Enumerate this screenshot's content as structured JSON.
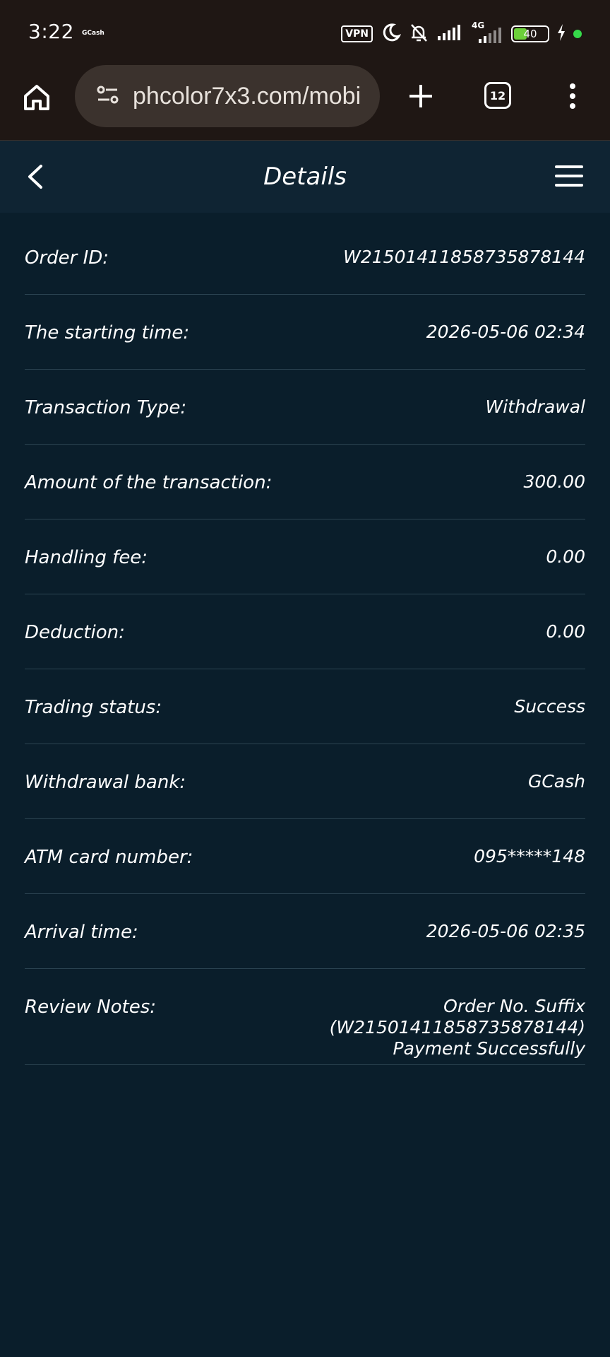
{
  "status_bar": {
    "time": "3:22",
    "notification": "GCash",
    "vpn": "VPN",
    "network": "4G",
    "battery": "40"
  },
  "browser": {
    "url": "phcolor7x3.com/mobi",
    "tab_count": "12"
  },
  "header": {
    "title": "Details"
  },
  "details": [
    {
      "label": "Order ID:",
      "value": "W21501411858735878144"
    },
    {
      "label": "The starting time:",
      "value": "2026-05-06 02:34"
    },
    {
      "label": "Transaction Type:",
      "value": "Withdrawal"
    },
    {
      "label": "Amount of the transaction:",
      "value": "300.00"
    },
    {
      "label": "Handling fee:",
      "value": "0.00"
    },
    {
      "label": "Deduction:",
      "value": "0.00"
    },
    {
      "label": "Trading status:",
      "value": "Success"
    },
    {
      "label": "Withdrawal bank:",
      "value": "GCash"
    },
    {
      "label": "ATM card number:",
      "value": "095*****148"
    },
    {
      "label": "Arrival time:",
      "value": "2026-05-06 02:35"
    }
  ],
  "review_notes": {
    "label": "Review Notes:",
    "value_line1": "Order No. Suffix (W21501411858735878144)",
    "value_line2": "Payment Successfully"
  }
}
